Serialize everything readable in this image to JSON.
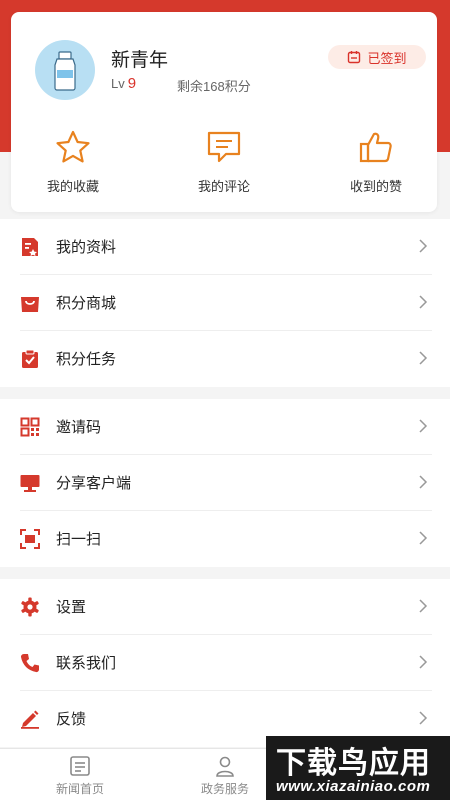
{
  "profile": {
    "username": "新青年",
    "level_prefix": "Lv",
    "level": "9",
    "points_text": "剩余168积分",
    "signin_label": "已签到"
  },
  "quick_actions": [
    {
      "label": "我的收藏",
      "icon": "star-icon"
    },
    {
      "label": "我的评论",
      "icon": "comment-icon"
    },
    {
      "label": "收到的赞",
      "icon": "thumbs-up-icon"
    }
  ],
  "menu_groups": [
    [
      {
        "label": "我的资料",
        "icon": "profile-doc-icon"
      },
      {
        "label": "积分商城",
        "icon": "shopping-bag-icon"
      },
      {
        "label": "积分任务",
        "icon": "task-clipboard-icon"
      }
    ],
    [
      {
        "label": "邀请码",
        "icon": "qr-code-icon"
      },
      {
        "label": "分享客户端",
        "icon": "monitor-icon"
      },
      {
        "label": "扫一扫",
        "icon": "scan-icon"
      }
    ],
    [
      {
        "label": "设置",
        "icon": "gear-icon"
      },
      {
        "label": "联系我们",
        "icon": "phone-icon"
      },
      {
        "label": "反馈",
        "icon": "pencil-icon"
      }
    ]
  ],
  "tabs": [
    {
      "label": "新闻首页",
      "icon": "news-icon"
    },
    {
      "label": "政务服务",
      "icon": "person-service-icon"
    }
  ],
  "watermark": {
    "line1": "下载鸟应用",
    "line2": "www.xiazainiao.com"
  },
  "colors": {
    "accent": "#d5392c",
    "quick_icon": "#e8821f",
    "signin_bg": "#fdece6"
  }
}
